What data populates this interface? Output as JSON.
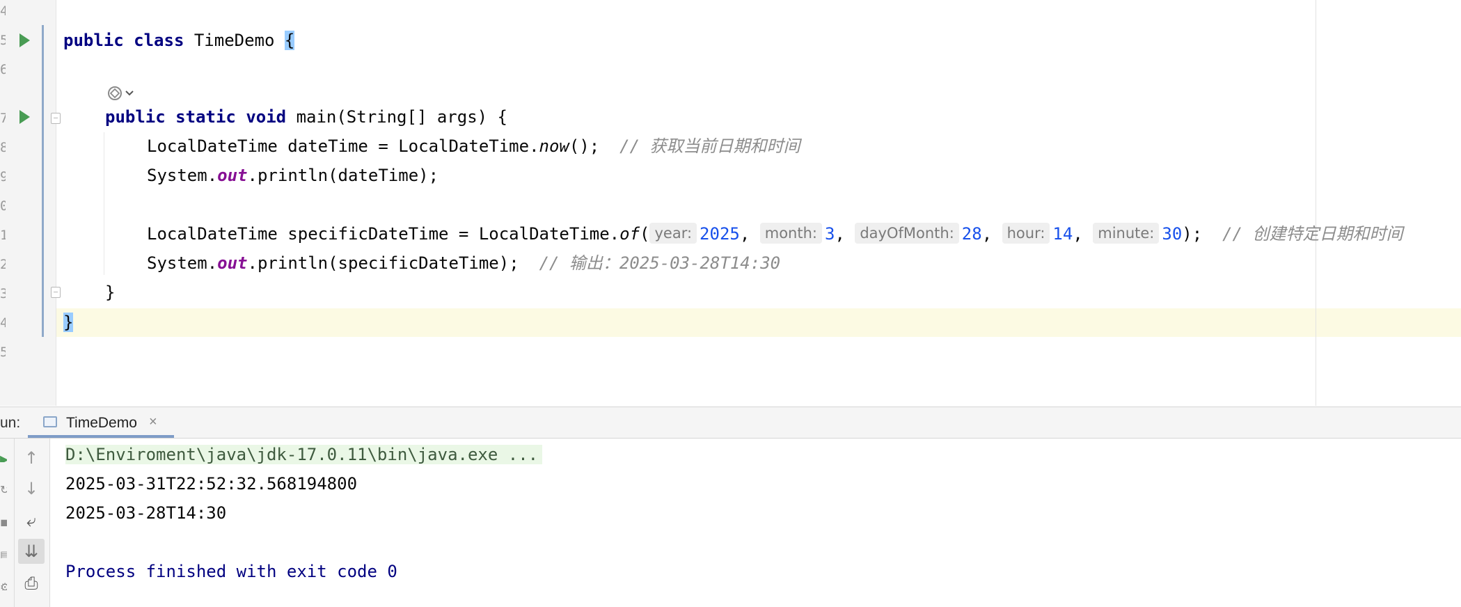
{
  "editor": {
    "line_numbers": [
      "4",
      "5",
      "6",
      "7",
      "8",
      "9",
      "0",
      "1",
      "2",
      "3",
      "4",
      "5"
    ],
    "class_decl": {
      "kw1": "public",
      "kw2": "class",
      "name": "TimeDemo",
      "brace": "{"
    },
    "main_decl": {
      "kw1": "public",
      "kw2": "static",
      "kw3": "void",
      "rest": "main(String[] args) {"
    },
    "line_datetime": {
      "pre": "LocalDateTime dateTime = LocalDateTime.",
      "call": "now",
      "post": "();",
      "comment": "// 获取当前日期和时间"
    },
    "line_print1": {
      "pre": "System.",
      "field": "out",
      "post": ".println(dateTime);"
    },
    "line_specific": {
      "pre": "LocalDateTime specificDateTime = LocalDateTime.",
      "call": "of",
      "paren": "(",
      "params": [
        {
          "hint": "year:",
          "value": "2025",
          "sep": ", "
        },
        {
          "hint": "month:",
          "value": "3",
          "sep": ", "
        },
        {
          "hint": "dayOfMonth:",
          "value": "28",
          "sep": ", "
        },
        {
          "hint": "hour:",
          "value": "14",
          "sep": ", "
        },
        {
          "hint": "minute:",
          "value": "30",
          "sep": ""
        }
      ],
      "close": ");",
      "comment": "// 创建特定日期和时间"
    },
    "line_print2": {
      "pre": "System.",
      "field": "out",
      "post": ".println(specificDateTime);",
      "comment": "// 输出：2025-03-28T14:30"
    },
    "close_method": "}",
    "close_class": "}"
  },
  "run_panel": {
    "label": "un:",
    "tab_label": "TimeDemo",
    "tab_close": "×",
    "tools": [
      "↑",
      "↓",
      "⤶",
      "⇊",
      "⎙"
    ],
    "output": {
      "command": "D:\\Enviroment\\java\\jdk-17.0.11\\bin\\java.exe ...",
      "lines": [
        "2025-03-31T22:52:32.568194800",
        "2025-03-28T14:30"
      ],
      "exit": "Process finished with exit code 0"
    }
  },
  "colors": {
    "keyword": "#000080",
    "number": "#1750eb",
    "comment": "#8c8c8c",
    "static_field": "#871094",
    "run_icon": "#499c54",
    "caret_row": "#fcfae3"
  }
}
